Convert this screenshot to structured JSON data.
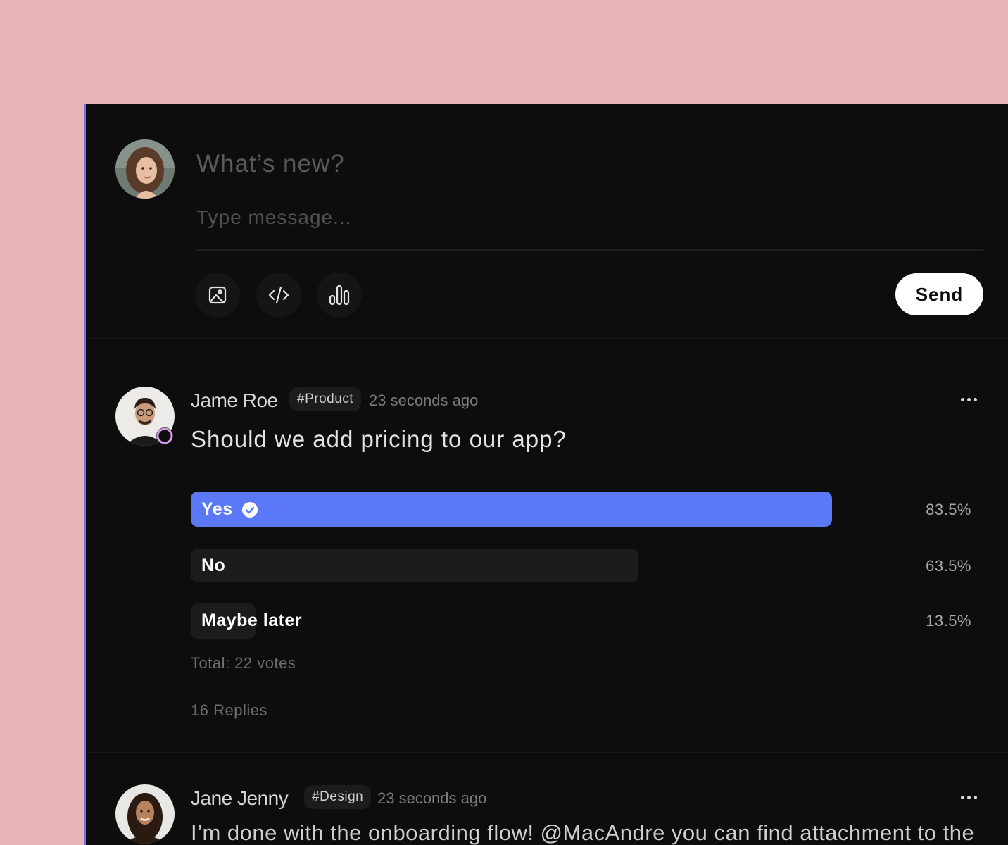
{
  "composer": {
    "title": "What’s new?",
    "placeholder": "Type message...",
    "tools": [
      {
        "icon": "image-icon"
      },
      {
        "icon": "code-icon"
      },
      {
        "icon": "poll-chart-icon"
      }
    ],
    "send_label": "Send"
  },
  "posts": [
    {
      "author": "Jame Roe",
      "tag": "#Product",
      "time": "23 seconds ago",
      "question": "Should we add pricing to our app?",
      "options": [
        {
          "label": "Yes",
          "percent_label": "83.5%",
          "fill": 0.835,
          "selected": true
        },
        {
          "label": "No",
          "percent_label": "63.5%",
          "fill": 0.635,
          "selected": false
        },
        {
          "label": "Maybe later",
          "percent_label": "13.5%",
          "fill": 0.135,
          "selected": false
        }
      ],
      "total": "Total: 22 votes",
      "replies": "16 Replies"
    },
    {
      "author": "Jane Jenny",
      "tag": "#Design",
      "time": "23 seconds ago",
      "body": "I’m done with the onboarding flow! @MacAndre you can find attachment to the"
    }
  ],
  "colors": {
    "background": "#e6b4b9",
    "panel": "#0d0d0e",
    "accent": "#5b79f7",
    "option_bar": "#1c1c1f",
    "status_ring": "#d59be6"
  }
}
